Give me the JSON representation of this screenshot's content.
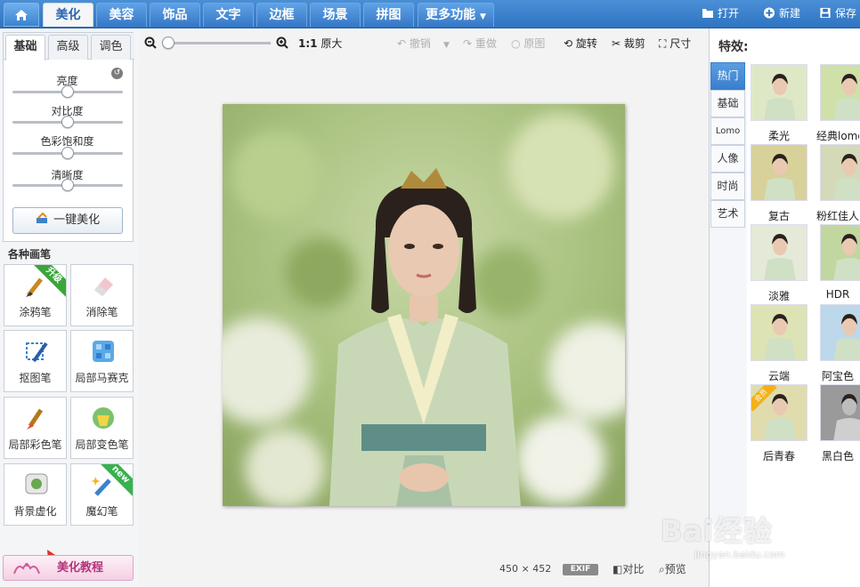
{
  "nav": {
    "home_icon": "home-icon",
    "tabs": [
      "美化",
      "美容",
      "饰品",
      "文字",
      "边框",
      "场景",
      "拼图",
      "更多功能"
    ],
    "active_tab": "美化",
    "actions": {
      "open": "打开",
      "new": "新建",
      "save": "保存"
    }
  },
  "left": {
    "subtabs": [
      "基础",
      "高级",
      "调色"
    ],
    "active_subtab": "基础",
    "sliders": [
      {
        "label": "亮度",
        "value": 0.5
      },
      {
        "label": "对比度",
        "value": 0.5
      },
      {
        "label": "色彩饱和度",
        "value": 0.5
      },
      {
        "label": "清晰度",
        "value": 0.5
      }
    ],
    "onekey_label": "一键美化",
    "brush_title": "各种画笔",
    "brushes": [
      {
        "label": "涂鸦笔",
        "badge": "升级"
      },
      {
        "label": "消除笔",
        "badge": ""
      },
      {
        "label": "抠图笔",
        "badge": ""
      },
      {
        "label": "局部马赛克",
        "badge": ""
      },
      {
        "label": "局部彩色笔",
        "badge": ""
      },
      {
        "label": "局部变色笔",
        "badge": ""
      },
      {
        "label": "背景虚化",
        "badge": ""
      },
      {
        "label": "魔幻笔",
        "badge": "new"
      }
    ],
    "tutorial_label": "美化教程"
  },
  "canvas": {
    "zoom_value": 0.0,
    "actual_size_ratio": "1:1",
    "actual_size_label": "原大",
    "undo": "撤销",
    "redo": "重做",
    "original": "原图",
    "rotate": "旋转",
    "crop": "裁剪",
    "resize": "尺寸",
    "width": "450",
    "times": "×",
    "height": "452",
    "exif": "EXIF",
    "compare": "对比",
    "preview": "预览"
  },
  "right": {
    "title": "特效:",
    "tabs": [
      "热门",
      "基础",
      "Lomo",
      "人像",
      "时尚",
      "艺术"
    ],
    "active_tab": "热门",
    "effects": [
      {
        "label": "柔光",
        "badge": ""
      },
      {
        "label": "经典lomo",
        "badge": ""
      },
      {
        "label": "复古",
        "badge": ""
      },
      {
        "label": "粉红佳人",
        "badge": ""
      },
      {
        "label": "淡雅",
        "badge": ""
      },
      {
        "label": "HDR",
        "badge": ""
      },
      {
        "label": "云端",
        "badge": ""
      },
      {
        "label": "阿宝色",
        "badge": ""
      },
      {
        "label": "后青春",
        "badge": "会员"
      },
      {
        "label": "黑白色",
        "badge": ""
      }
    ]
  },
  "watermark": {
    "brand": "Bai经验",
    "url": "jingyan.baidu.com"
  }
}
